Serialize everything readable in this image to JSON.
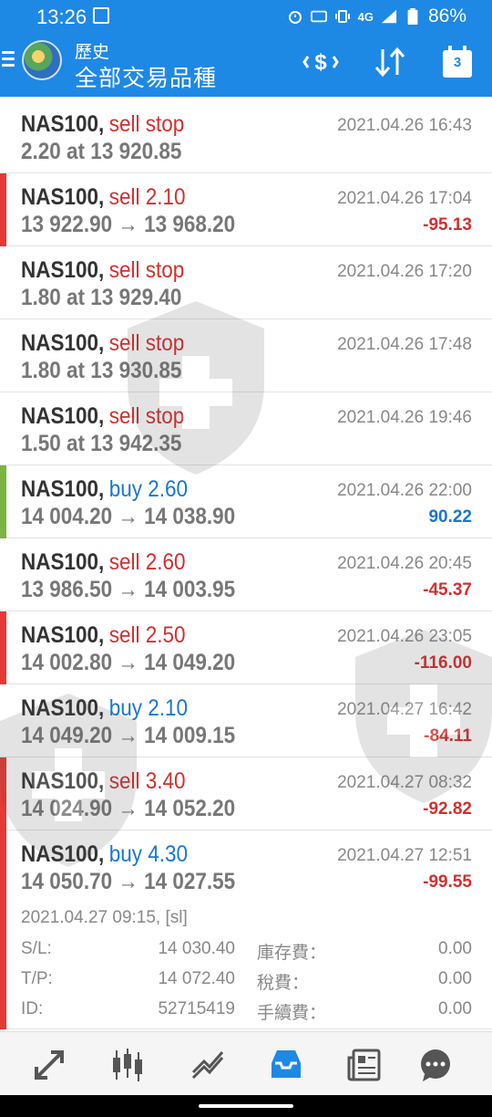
{
  "status_bar": {
    "time": "13:26",
    "network": "4G",
    "battery": "86%"
  },
  "header": {
    "title": "歷史",
    "subtitle": "全部交易品種",
    "calendar_day": "3"
  },
  "colors": {
    "header_bg": "#1e88e5",
    "sell": "#d32f2f",
    "buy": "#1976d2",
    "loss_flag": "#e53935",
    "profit_flag": "#7cb342"
  },
  "trades": [
    {
      "symbol": "NAS100,",
      "action": "sell stop",
      "side": "sell",
      "line2": "2.20 at 13 920.85",
      "date": "2021.04.26 16:43",
      "profit": "",
      "flag": ""
    },
    {
      "symbol": "NAS100,",
      "action": "sell 2.10",
      "side": "sell",
      "line2": "13 922.90 → 13 968.20",
      "date": "2021.04.26 17:04",
      "profit": "-95.13",
      "flag": "loss"
    },
    {
      "symbol": "NAS100,",
      "action": "sell stop",
      "side": "sell",
      "line2": "1.80 at 13 929.40",
      "date": "2021.04.26 17:20",
      "profit": "",
      "flag": ""
    },
    {
      "symbol": "NAS100,",
      "action": "sell stop",
      "side": "sell",
      "line2": "1.80 at 13 930.85",
      "date": "2021.04.26 17:48",
      "profit": "",
      "flag": ""
    },
    {
      "symbol": "NAS100,",
      "action": "sell stop",
      "side": "sell",
      "line2": "1.50 at 13 942.35",
      "date": "2021.04.26 19:46",
      "profit": "",
      "flag": ""
    },
    {
      "symbol": "NAS100,",
      "action": "buy 2.60",
      "side": "buy",
      "line2": "14 004.20 → 14 038.90",
      "date": "2021.04.26 22:00",
      "profit": "90.22",
      "flag": "profit"
    },
    {
      "symbol": "NAS100,",
      "action": "sell 2.60",
      "side": "sell",
      "line2": "13 986.50 → 14 003.95",
      "date": "2021.04.26 20:45",
      "profit": "-45.37",
      "flag": ""
    },
    {
      "symbol": "NAS100,",
      "action": "sell 2.50",
      "side": "sell",
      "line2": "14 002.80 → 14 049.20",
      "date": "2021.04.26 23:05",
      "profit": "-116.00",
      "flag": "loss"
    },
    {
      "symbol": "NAS100,",
      "action": "buy 2.10",
      "side": "buy",
      "line2": "14 049.20 → 14 009.15",
      "date": "2021.04.27 16:42",
      "profit": "-84.11",
      "flag": ""
    },
    {
      "symbol": "NAS100,",
      "action": "sell 3.40",
      "side": "sell",
      "line2": "14 024.90 → 14 052.20",
      "date": "2021.04.27 08:32",
      "profit": "-92.82",
      "flag": "loss"
    }
  ],
  "expanded_trade": {
    "symbol": "NAS100,",
    "action": "buy 4.30",
    "side": "buy",
    "line2": "14 050.70 → 14 027.55",
    "date": "2021.04.27 12:51",
    "profit": "-99.55",
    "flag": "loss",
    "open_info": "2021.04.27 09:15, [sl]",
    "sl_label": "S/L:",
    "sl_value": "14 030.40",
    "tp_label": "T/P:",
    "tp_value": "14 072.40",
    "id_label": "ID:",
    "id_value": "52715419",
    "swap_label": "庫存費：",
    "swap_value": "0.00",
    "tax_label": "稅費：",
    "tax_value": "0.00",
    "commission_label": "手續費：",
    "commission_value": "0.00"
  },
  "bottom_nav": [
    "quotes-icon",
    "chart-candles-icon",
    "trade-icon",
    "history-icon",
    "news-icon",
    "chat-icon"
  ]
}
